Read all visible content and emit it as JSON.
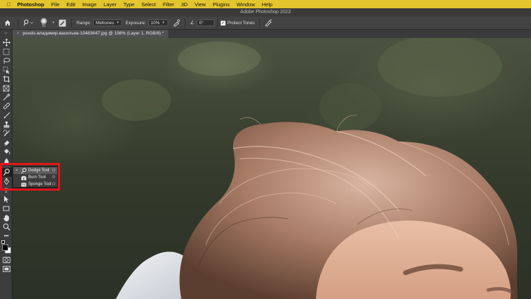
{
  "menubar": {
    "apple_icon": "apple-logo-icon",
    "items": [
      "Photoshop",
      "File",
      "Edit",
      "Image",
      "Layer",
      "Type",
      "Select",
      "Filter",
      "3D",
      "View",
      "Plugins",
      "Window",
      "Help"
    ]
  },
  "window": {
    "title": "Adobe Photoshop 2023"
  },
  "options": {
    "brush_size": "70",
    "range_label": "Range:",
    "range_value": "Midtones",
    "exposure_label": "Exposure:",
    "exposure_value": "10%",
    "angle_value": "0°",
    "protect_tones_label": "Protect Tones",
    "protect_tones_checked": true
  },
  "document": {
    "tab_title": "pexels-владимир-васильев-10483647.jpg @ 198% (Layer 1, RGB/8) *"
  },
  "flyout": {
    "items": [
      {
        "label": "Dodge Tool",
        "key": "O",
        "icon": "dodge-tool-icon",
        "selected": true
      },
      {
        "label": "Burn Tool",
        "key": "O",
        "icon": "burn-tool-icon",
        "selected": false
      },
      {
        "label": "Sponge Tool",
        "key": "O",
        "icon": "sponge-tool-icon",
        "selected": false
      }
    ]
  },
  "colors": {
    "menubar": "#e3c52e",
    "highlight": "#e8131b",
    "panel": "#3c3c3c"
  }
}
